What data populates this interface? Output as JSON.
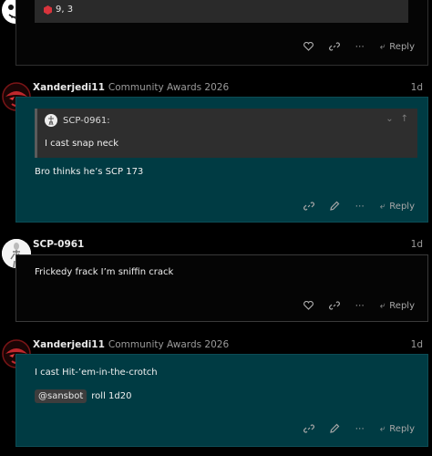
{
  "post0": {
    "dice_text": "9, 3",
    "reply_label": "Reply"
  },
  "post1": {
    "username": "Xanderjedi11",
    "award": "Community Awards 2026",
    "date": "1d",
    "quote_author": "SCP-0961:",
    "quote_text": "I cast snap neck",
    "body": "Bro thinks he’s SCP 173",
    "reply_label": "Reply"
  },
  "post2": {
    "username": "SCP-0961",
    "date": "1d",
    "body": "Frickedy frack I’m sniffin crack",
    "reply_label": "Reply"
  },
  "post3": {
    "username": "Xanderjedi11",
    "award": "Community Awards 2026",
    "date": "1d",
    "body": "I cast Hit-’em-in-the-crotch",
    "mention": "@sansbot",
    "command": "roll 1d20",
    "reply_label": "Reply"
  },
  "colors": {
    "teal_card": "#003b43",
    "dark_card": "#050505",
    "accent_red": "#c0282d"
  }
}
